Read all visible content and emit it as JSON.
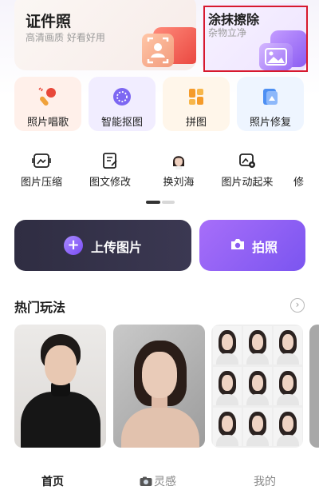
{
  "cards": {
    "id_photo": {
      "title": "证件照",
      "subtitle": "高清画质 好看好用"
    },
    "erase": {
      "title": "涂抹擦除",
      "subtitle": "杂物立净"
    }
  },
  "tiles": [
    {
      "label": "照片唱歌",
      "icon": "microphone-icon"
    },
    {
      "label": "智能抠图",
      "icon": "cutout-icon"
    },
    {
      "label": "拼图",
      "icon": "collage-icon"
    },
    {
      "label": "照片修复",
      "icon": "photo-repair-icon"
    }
  ],
  "tools": [
    {
      "label": "图片压缩",
      "icon": "compress-icon"
    },
    {
      "label": "图文修改",
      "icon": "edit-document-icon"
    },
    {
      "label": "换刘海",
      "icon": "bangs-avatar-icon"
    },
    {
      "label": "图片动起来",
      "icon": "animate-photo-icon"
    },
    {
      "label": "修",
      "icon": "more-tool-icon"
    }
  ],
  "actions": {
    "upload": {
      "label": "上传图片",
      "icon": "plus-icon"
    },
    "camera": {
      "label": "拍照",
      "icon": "camera-icon"
    }
  },
  "hot": {
    "title": "热门玩法",
    "more_icon": "chevron-right-icon"
  },
  "bottom_nav": {
    "home": "首页",
    "inspiration": "灵感",
    "mine": "我的"
  },
  "colors": {
    "accent_purple": "#7b55f0",
    "upload_dark": "#2f2d42",
    "highlight_frame": "#d7192e"
  }
}
